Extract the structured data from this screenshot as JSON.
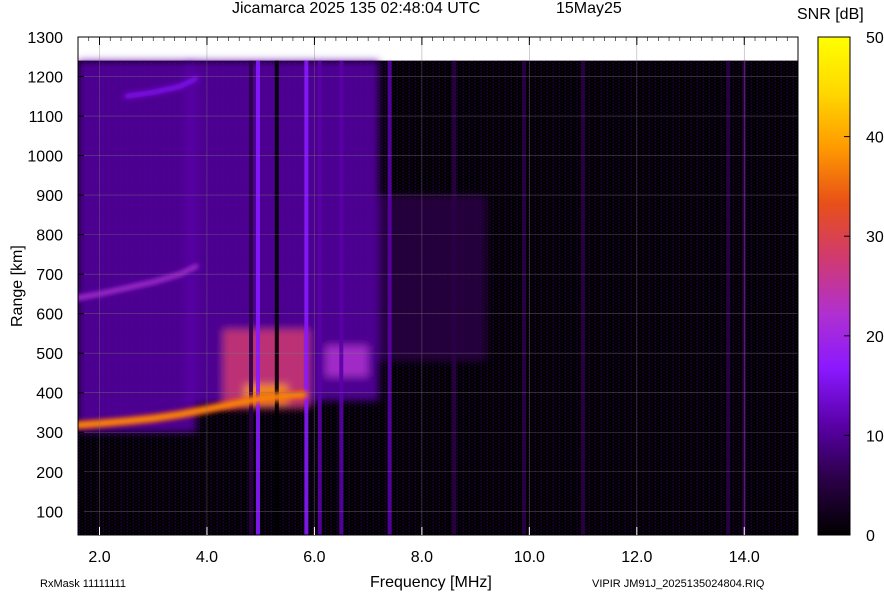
{
  "chart_data": {
    "type": "heatmap",
    "title": "Jicamarca 2025 135 02:48:04 UTC",
    "subtitle": "15May25",
    "xlabel": "Frequency [MHz]",
    "ylabel": "Range [km]",
    "xlim": [
      1.6,
      15.0
    ],
    "ylim": [
      40,
      1300
    ],
    "x_ticks": [
      "2.0",
      "4.0",
      "6.0",
      "8.0",
      "10.0",
      "12.0",
      "14.0"
    ],
    "x_tick_values": [
      2,
      4,
      6,
      8,
      10,
      12,
      14
    ],
    "y_ticks": [
      "100",
      "200",
      "300",
      "400",
      "500",
      "600",
      "700",
      "800",
      "900",
      "1000",
      "1100",
      "1200",
      "1300"
    ],
    "y_tick_values": [
      100,
      200,
      300,
      400,
      500,
      600,
      700,
      800,
      900,
      1000,
      1100,
      1200,
      1300
    ],
    "grid": true,
    "colorbar": {
      "title": "SNR [dB]",
      "range": [
        0,
        50
      ],
      "ticks": [
        "0",
        "10",
        "20",
        "30",
        "40",
        "50"
      ],
      "tick_values": [
        0,
        10,
        20,
        30,
        40,
        50
      ],
      "colormap": [
        "#000000",
        "#2a0046",
        "#5a00a8",
        "#8a18ff",
        "#b030d0",
        "#d03a70",
        "#e85018",
        "#ff9a00",
        "#ffd800",
        "#ffff00"
      ]
    },
    "data_ceiling_km": 1240,
    "traces": [
      {
        "x": [
          1.6,
          2.0,
          2.5,
          3.0,
          3.5,
          4.0,
          4.5,
          5.0,
          5.5,
          5.8
        ],
        "y": [
          318,
          322,
          328,
          335,
          345,
          358,
          372,
          385,
          392,
          395
        ],
        "snr": 32
      },
      {
        "x": [
          1.6,
          2.0,
          2.5,
          3.0,
          3.5,
          3.8
        ],
        "y": [
          640,
          650,
          665,
          680,
          700,
          720
        ],
        "snr": 12
      },
      {
        "x": [
          2.5,
          3.0,
          3.5,
          3.8
        ],
        "y": [
          1150,
          1160,
          1175,
          1195
        ],
        "snr": 10
      }
    ],
    "regions": [
      {
        "x": [
          1.6,
          3.8
        ],
        "y": [
          300,
          1240
        ],
        "snr": 10
      },
      {
        "x": [
          3.6,
          6.0
        ],
        "y": [
          370,
          1240
        ],
        "snr": 12
      },
      {
        "x": [
          6.0,
          7.2
        ],
        "y": [
          380,
          1240
        ],
        "snr": 9
      },
      {
        "x": [
          7.2,
          9.2
        ],
        "y": [
          480,
          900
        ],
        "snr": 5
      },
      {
        "x": [
          4.3,
          5.9
        ],
        "y": [
          360,
          560
        ],
        "snr": 26
      },
      {
        "x": [
          6.2,
          7.0
        ],
        "y": [
          440,
          520
        ],
        "snr": 24
      },
      {
        "x": [
          4.7,
          5.5
        ],
        "y": [
          370,
          420
        ],
        "snr": 38
      }
    ],
    "stripes": [
      {
        "x": 4.82,
        "snr": 3
      },
      {
        "x": 4.95,
        "snr": 16
      },
      {
        "x": 5.3,
        "snr": 2
      },
      {
        "x": 5.85,
        "snr": 15
      },
      {
        "x": 6.1,
        "snr": 13
      },
      {
        "x": 6.5,
        "snr": 12
      },
      {
        "x": 7.4,
        "snr": 9
      },
      {
        "x": 8.6,
        "snr": 6
      },
      {
        "x": 9.9,
        "snr": 8
      },
      {
        "x": 11.0,
        "snr": 5
      },
      {
        "x": 13.7,
        "snr": 6
      },
      {
        "x": 14.0,
        "snr": 5
      }
    ]
  },
  "footer": {
    "rx_mask": "RxMask 11111111",
    "file": "VIPIR  JM91J_2025135024804.RIQ"
  }
}
